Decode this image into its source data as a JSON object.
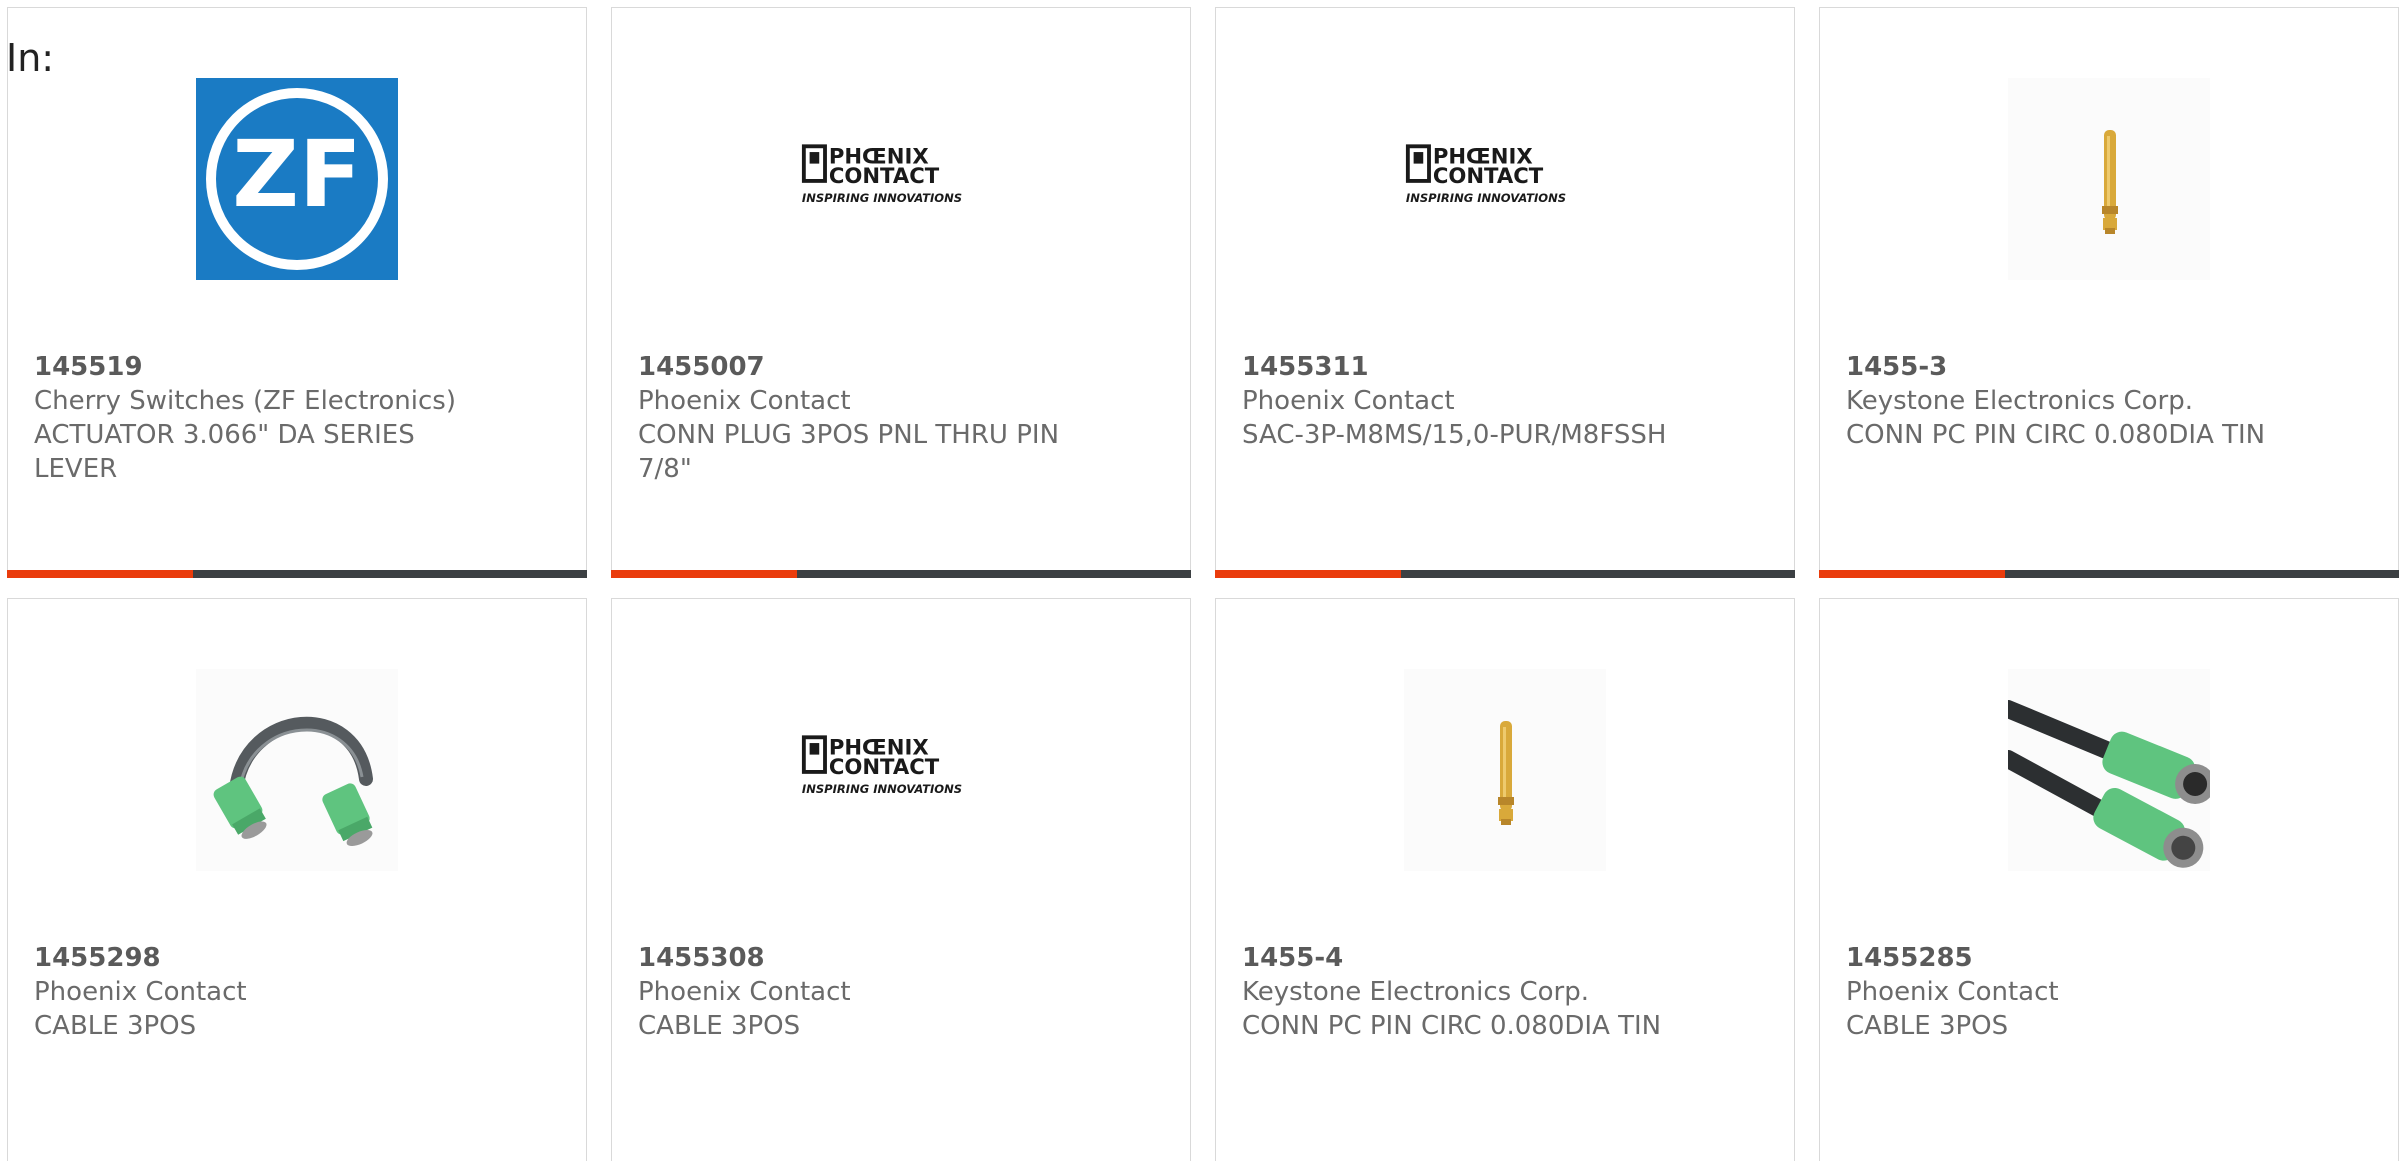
{
  "page": {
    "in_label": "In:"
  },
  "colors": {
    "accent": "#ea3c0c",
    "bar": "#3c4043",
    "border": "#d9d9d9",
    "text": "#5a5a5a",
    "zf_blue": "#1a7bc4",
    "phoenix_text": "#1a1a1a",
    "pin_gold": "#d9a93a",
    "cable_green": "#5fc47f"
  },
  "products": [
    {
      "part_number": "145519",
      "manufacturer": "Cherry Switches (ZF Electronics)",
      "description": "ACTUATOR 3.066\" DA SERIES LEVER",
      "image": "zf-logo",
      "accent_fraction": 0.32
    },
    {
      "part_number": "1455007",
      "manufacturer": "Phoenix Contact",
      "description": "CONN PLUG 3POS PNL THRU PIN 7/8\"",
      "image": "phoenix-contact-logo",
      "accent_fraction": 0.32
    },
    {
      "part_number": "1455311",
      "manufacturer": "Phoenix Contact",
      "description": "SAC-3P-M8MS/15,0-PUR/M8FSSH",
      "image": "phoenix-contact-logo",
      "accent_fraction": 0.32
    },
    {
      "part_number": "1455-3",
      "manufacturer": "Keystone Electronics Corp.",
      "description": "CONN PC PIN CIRC 0.080DIA TIN",
      "image": "gold-pin",
      "accent_fraction": 0.32
    },
    {
      "part_number": "1455298",
      "manufacturer": "Phoenix Contact",
      "description": "CABLE 3POS",
      "image": "cable-assembly",
      "accent_fraction": 0.32
    },
    {
      "part_number": "1455308",
      "manufacturer": "Phoenix Contact",
      "description": "CABLE 3POS",
      "image": "phoenix-contact-logo",
      "accent_fraction": 0.32
    },
    {
      "part_number": "1455-4",
      "manufacturer": "Keystone Electronics Corp.",
      "description": "CONN PC PIN CIRC 0.080DIA TIN",
      "image": "gold-pin",
      "accent_fraction": 0.32
    },
    {
      "part_number": "1455285",
      "manufacturer": "Phoenix Contact",
      "description": "CABLE 3POS",
      "image": "cable-connectors",
      "accent_fraction": 0.32
    }
  ],
  "logos": {
    "phoenix_line1": "PHŒNIX",
    "phoenix_line2": "CONTACT",
    "phoenix_tagline": "INSPIRING INNOVATIONS",
    "zf": "ZF"
  }
}
